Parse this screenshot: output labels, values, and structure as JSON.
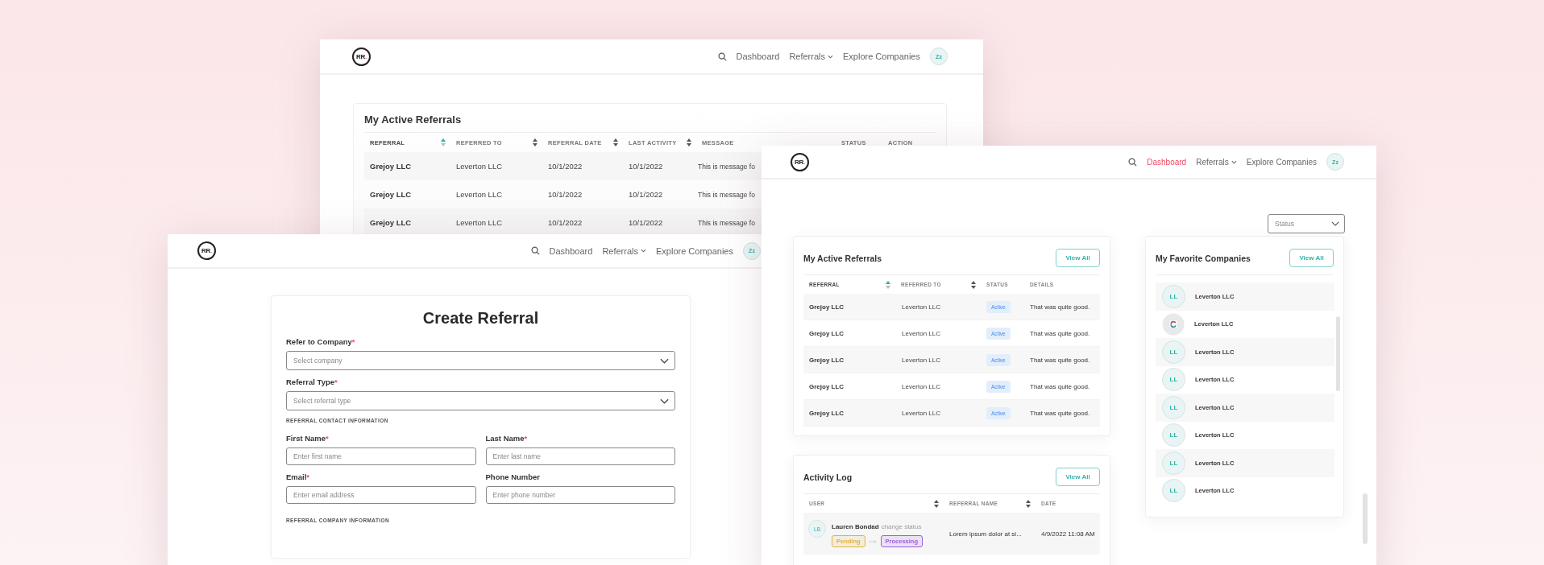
{
  "back_window": {
    "logo": {
      "letters": "RR",
      "dot": "."
    },
    "nav": [
      {
        "label": "Dashboard",
        "kind": "link",
        "selected": false
      },
      {
        "label": "Referrals",
        "kind": "dropdown",
        "selected": false
      },
      {
        "label": "Explore Companies",
        "kind": "link",
        "selected": false
      }
    ],
    "avatar": "Zz",
    "card": {
      "title": "My Active Referrals",
      "columns": [
        {
          "label": "REFERRAL",
          "sorted": true
        },
        {
          "label": "REFERRED TO",
          "sorted": false
        },
        {
          "label": "REFERRAL DATE",
          "sorted": false
        },
        {
          "label": "LAST ACTIVITY",
          "sorted": false
        },
        {
          "label": "MESSAGE"
        },
        {
          "label": "STATUS"
        },
        {
          "label": "ACTION"
        }
      ],
      "rows": [
        {
          "referral": "Grejoy LLC",
          "referred_to": "Leverton LLC",
          "referral_date": "10/1/2022",
          "last_activity": "10/1/2022",
          "message": "This is message fo"
        },
        {
          "referral": "Grejoy LLC",
          "referred_to": "Leverton LLC",
          "referral_date": "10/1/2022",
          "last_activity": "10/1/2022",
          "message": "This is message fo"
        },
        {
          "referral": "Grejoy LLC",
          "referred_to": "Leverton LLC",
          "referral_date": "10/1/2022",
          "last_activity": "10/1/2022",
          "message": "This is message fo"
        }
      ]
    }
  },
  "form_window": {
    "logo": {
      "letters": "RR",
      "dot": "."
    },
    "nav": [
      {
        "label": "Dashboard",
        "kind": "link",
        "selected": false
      },
      {
        "label": "Referrals",
        "kind": "dropdown",
        "selected": false
      },
      {
        "label": "Explore Companies",
        "kind": "link",
        "selected": false
      }
    ],
    "avatar": "Zz",
    "form": {
      "title": "Create Referral",
      "items": [
        {
          "kind": "select",
          "label": "Refer to Company",
          "marker": "*",
          "placeholder": "Select company"
        },
        {
          "kind": "select",
          "label": "Referral Type",
          "marker": "*",
          "placeholder": "Select referral type"
        },
        {
          "kind": "section",
          "label": "REFERRAL CONTACT INFORMATION"
        },
        {
          "kind": "pair",
          "fields": [
            {
              "label": "First Name",
              "marker": "*",
              "placeholder": "Enter first name"
            },
            {
              "label": "Last Name",
              "marker": "*",
              "placeholder": "Enter last name"
            }
          ]
        },
        {
          "kind": "pair",
          "fields": [
            {
              "label": "Email",
              "marker": "*",
              "placeholder": "Enter email address"
            },
            {
              "label": "Phone Number",
              "placeholder": "Enter phone number"
            }
          ]
        },
        {
          "kind": "section",
          "label": "REFERRAL COMPANY INFORMATION"
        }
      ]
    }
  },
  "dashboard_window": {
    "logo": {
      "letters": "RR",
      "dot": "."
    },
    "nav": [
      {
        "label": "Dashboard",
        "kind": "link",
        "selected": true
      },
      {
        "label": "Referrals",
        "kind": "dropdown",
        "selected": false
      },
      {
        "label": "Explore Companies",
        "kind": "link",
        "selected": false
      }
    ],
    "avatar": "Zz",
    "status_filter": {
      "placeholder": "Status"
    },
    "referrals_card": {
      "title": "My Active Referrals",
      "button": "View All",
      "columns": [
        {
          "label": "REFERRAL",
          "sorted": true
        },
        {
          "label": "REFERRED TO",
          "sorted": false
        },
        {
          "label": "STATUS"
        },
        {
          "label": "DETAILS"
        }
      ],
      "rows": [
        {
          "referral": "Grejoy LLC",
          "referred_to": "Leverton LLC",
          "status": "Active",
          "details": "That was quite good."
        },
        {
          "referral": "Grejoy LLC",
          "referred_to": "Leverton LLC",
          "status": "Active",
          "details": "That was quite good."
        },
        {
          "referral": "Grejoy LLC",
          "referred_to": "Leverton LLC",
          "status": "Active",
          "details": "That was quite good."
        },
        {
          "referral": "Grejoy LLC",
          "referred_to": "Leverton LLC",
          "status": "Active",
          "details": "That was quite good."
        },
        {
          "referral": "Grejoy LLC",
          "referred_to": "Leverton LLC",
          "status": "Active",
          "details": "That was quite good."
        }
      ]
    },
    "activity_card": {
      "title": "Activity Log",
      "button": "View All",
      "columns": [
        {
          "label": "USER",
          "sorted": false
        },
        {
          "label": "REFERRAL NAME",
          "sorted": false
        },
        {
          "label": "DATE"
        }
      ],
      "rows": [
        {
          "initials": "LB",
          "user": "Lauren Bondad",
          "action": "change status",
          "status_change": [
            {
              "label": "Pending",
              "color": "#e2b33c"
            },
            {
              "label": "Processing",
              "color": "#a05ce0"
            }
          ],
          "referral_name": "Lorem ipsum dolor at si...",
          "date": "4/9/2022 11:08 AM"
        }
      ]
    },
    "favorites_card": {
      "title": "My Favorite Companies",
      "button": "View All",
      "companies": [
        {
          "kind": "initials",
          "initials": "LL",
          "name": "Leverton LLC"
        },
        {
          "kind": "logo",
          "name": "Leverton LLC"
        },
        {
          "kind": "initials",
          "initials": "LL",
          "name": "Leverton LLC"
        },
        {
          "kind": "initials",
          "initials": "LL",
          "name": "Leverton LLC"
        },
        {
          "kind": "initials",
          "initials": "LL",
          "name": "Leverton LLC"
        },
        {
          "kind": "initials",
          "initials": "LL",
          "name": "Leverton LLC"
        },
        {
          "kind": "initials",
          "initials": "LL",
          "name": "Leverton LLC"
        },
        {
          "kind": "initials",
          "initials": "LL",
          "name": "Leverton LLC"
        }
      ]
    }
  }
}
